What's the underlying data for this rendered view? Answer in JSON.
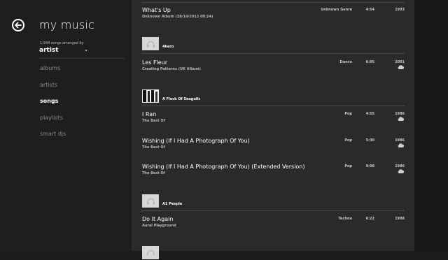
{
  "header": {
    "app_title": "my music",
    "arranged_by": "1,944 songs arranged by",
    "sort_value": "artist"
  },
  "nav": {
    "items": [
      {
        "label": "albums"
      },
      {
        "label": "artists"
      },
      {
        "label": "songs",
        "active": true
      },
      {
        "label": "playlists"
      },
      {
        "label": "smart djs"
      }
    ]
  },
  "songs": {
    "whats_up": {
      "title": "What's Up",
      "album": "Unknown Album (28/10/2012 00:24)",
      "genre": "Unknown Genre",
      "duration": "4:54",
      "year": "1993"
    },
    "les_fleur": {
      "title": "Les Fleur",
      "album": "Creating Patterns (UK Album)",
      "genre": "Dance",
      "duration": "6:05",
      "year": "2001",
      "cloud": true
    },
    "i_ran": {
      "title": "I Ran",
      "album": "The Best Of",
      "genre": "Pop",
      "duration": "4:55",
      "year": "1986",
      "cloud": true
    },
    "wishing": {
      "title": "Wishing (If I Had A Photograph Of You)",
      "album": "The Best Of",
      "genre": "Pop",
      "duration": "5:30",
      "year": "1986",
      "cloud": true
    },
    "wishing_ext": {
      "title": "Wishing (If I Had A Photograph Of You) (Extended Version)",
      "album": "The Best Of",
      "genre": "Pop",
      "duration": "9:08",
      "year": "1986",
      "cloud": true
    },
    "do_it_again": {
      "title": "Do It Again",
      "album": "Aural Playground",
      "genre": "Techno",
      "duration": "6:22",
      "year": "1998"
    }
  },
  "groups": {
    "g_4hero": {
      "name": "4hero"
    },
    "g_flock": {
      "name": "A Flock Of Seagulls"
    },
    "g_a1": {
      "name": "A1 People"
    }
  },
  "icons": {
    "back": "back-arrow-icon",
    "album_placeholder": "headphones-icon",
    "cloud": "cloud-icon"
  },
  "colors": {
    "background": "#1c1c1c",
    "list_panel": "#2a2a2a",
    "accent": "#ffffff"
  }
}
